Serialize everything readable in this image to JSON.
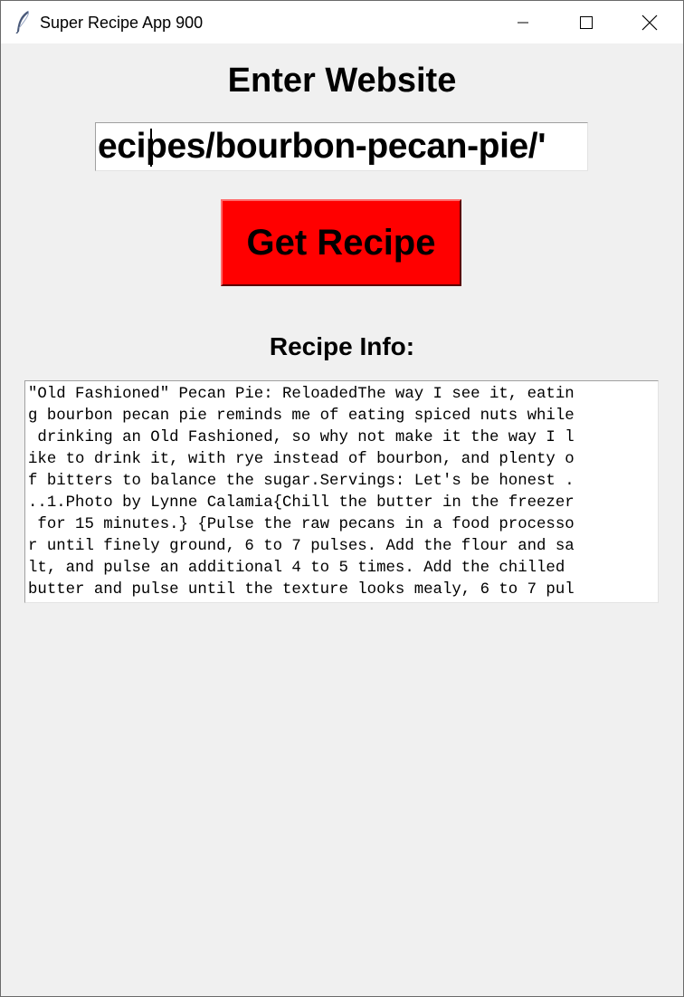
{
  "window": {
    "title": "Super Recipe App 900",
    "icon": "feather-icon",
    "controls": [
      "minimize-icon",
      "maximize-icon",
      "close-icon"
    ]
  },
  "main": {
    "heading": "Enter Website",
    "url_value": "ecipes/bourbon-pecan-pie/'",
    "button_label": "Get Recipe",
    "button_color": "#ff0000",
    "info_label": "Recipe Info:",
    "info_lines": [
      "\"Old Fashioned\" Pecan Pie: ReloadedThe way I see it, eatin",
      "g bourbon pecan pie reminds me of eating spiced nuts while",
      " drinking an Old Fashioned, so why not make it the way I l",
      "ike to drink it, with rye instead of bourbon, and plenty o",
      "f bitters to balance the sugar.Servings: Let's be honest .",
      "..1.Photo by Lynne Calamia{Chill the butter in the freezer",
      " for 15 minutes.} {Pulse the raw pecans in a food processo",
      "r until finely ground, 6 to 7 pulses. Add the flour and sa",
      "lt, and pulse an additional 4 to 5 times. Add the chilled ",
      "butter and pulse until the texture looks mealy, 6 to 7 pul"
    ]
  }
}
